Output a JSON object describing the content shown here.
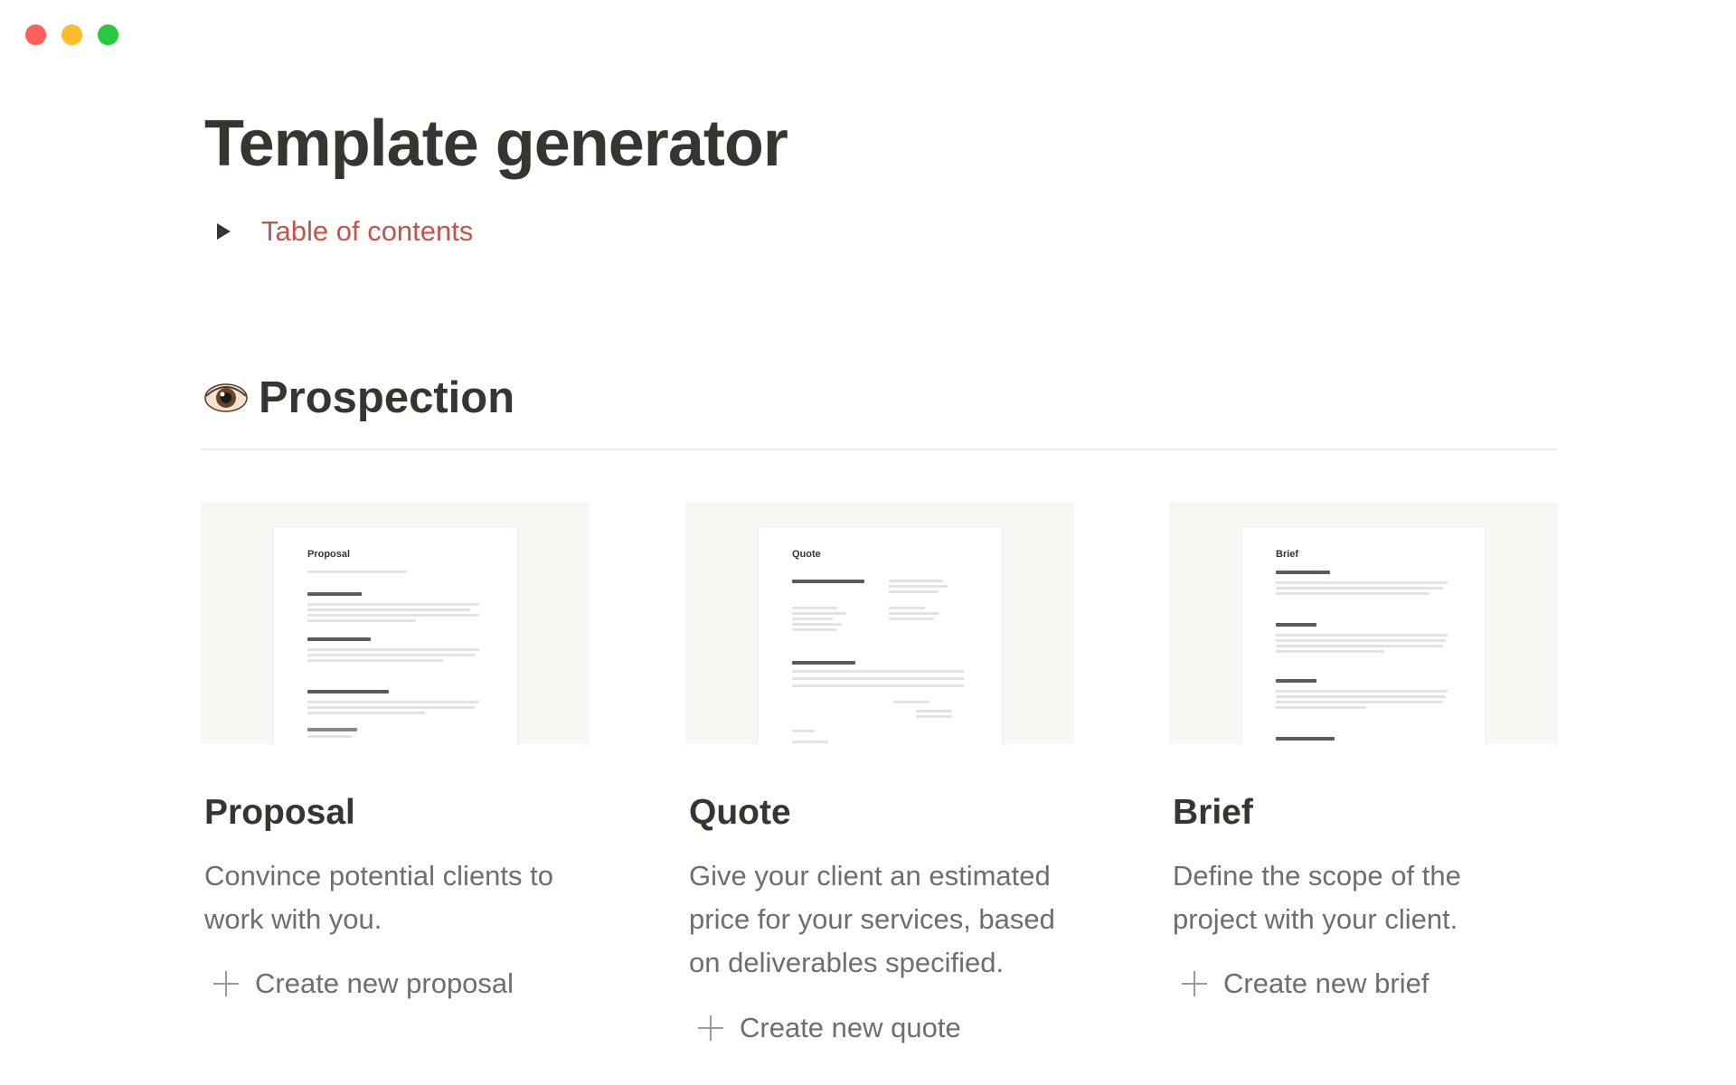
{
  "window": {
    "controls": [
      "close",
      "minimize",
      "maximize"
    ]
  },
  "page": {
    "title": "Template generator",
    "toc": {
      "label": "Table of contents",
      "icon": "triangle-right-icon",
      "color": "#c4554d"
    }
  },
  "section": {
    "icon": "eye-icon",
    "title": "Prospection"
  },
  "cards": [
    {
      "title": "Proposal",
      "description": "Convince potential clients to work with you.",
      "create_label": "Create new proposal",
      "preview_title": "Proposal"
    },
    {
      "title": "Quote",
      "description": "Give your client an estimated price for your services, based on deliverables specified.",
      "create_label": "Create new quote",
      "preview_title": "Quote"
    },
    {
      "title": "Brief",
      "description": "Define the scope of the project with your client.",
      "create_label": "Create new brief",
      "preview_title": "Brief"
    }
  ],
  "colors": {
    "text": "#37352f",
    "muted": "#6f6e69",
    "accent": "#c4554d",
    "thumb_bg": "#f8f7f4"
  }
}
